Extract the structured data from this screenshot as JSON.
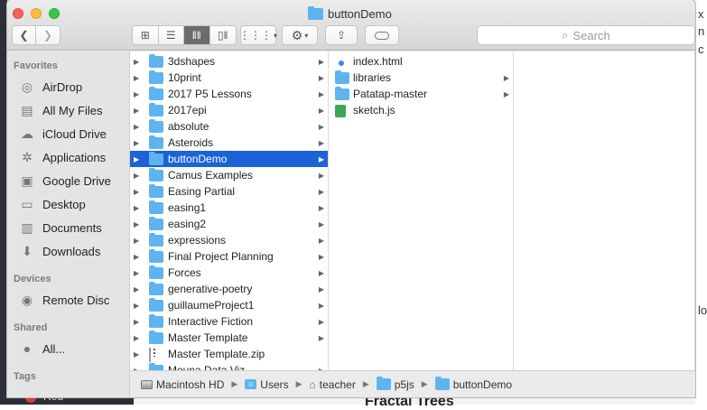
{
  "window": {
    "title": "buttonDemo"
  },
  "toolbar": {
    "back_icon": "chevron-left-icon",
    "forward_icon": "chevron-right-icon",
    "view_modes": [
      "icon-view",
      "list-view",
      "column-view",
      "gallery-view"
    ],
    "active_view": "column-view",
    "search_placeholder": "Search"
  },
  "sidebar": {
    "favorites_label": "Favorites",
    "favorites": [
      {
        "label": "AirDrop",
        "icon": "airdrop-icon"
      },
      {
        "label": "All My Files",
        "icon": "all-files-icon"
      },
      {
        "label": "iCloud Drive",
        "icon": "cloud-icon"
      },
      {
        "label": "Applications",
        "icon": "applications-icon"
      },
      {
        "label": "Google Drive",
        "icon": "google-drive-icon"
      },
      {
        "label": "Desktop",
        "icon": "desktop-icon"
      },
      {
        "label": "Documents",
        "icon": "documents-icon"
      },
      {
        "label": "Downloads",
        "icon": "downloads-icon"
      }
    ],
    "devices_label": "Devices",
    "devices": [
      {
        "label": "Remote Disc",
        "icon": "disc-icon"
      }
    ],
    "shared_label": "Shared",
    "shared": [
      {
        "label": "All...",
        "icon": "network-icon"
      }
    ],
    "tags_label": "Tags"
  },
  "column1": [
    {
      "label": "3dshapes",
      "type": "folder"
    },
    {
      "label": "10print",
      "type": "folder"
    },
    {
      "label": "2017 P5 Lessons",
      "type": "folder"
    },
    {
      "label": "2017epi",
      "type": "folder"
    },
    {
      "label": "absolute",
      "type": "folder"
    },
    {
      "label": "Asteroids",
      "type": "folder"
    },
    {
      "label": "buttonDemo",
      "type": "folder",
      "selected": true
    },
    {
      "label": "Camus Examples",
      "type": "folder"
    },
    {
      "label": "Easing Partial",
      "type": "folder"
    },
    {
      "label": "easing1",
      "type": "folder"
    },
    {
      "label": "easing2",
      "type": "folder"
    },
    {
      "label": "expressions",
      "type": "folder"
    },
    {
      "label": "Final Project Planning",
      "type": "folder"
    },
    {
      "label": "Forces",
      "type": "folder"
    },
    {
      "label": "generative-poetry",
      "type": "folder"
    },
    {
      "label": "guillaumeProject1",
      "type": "folder"
    },
    {
      "label": "Interactive Fiction",
      "type": "folder"
    },
    {
      "label": "Master Template",
      "type": "folder"
    },
    {
      "label": "Master Template.zip",
      "type": "zip"
    },
    {
      "label": "Mouna Data Viz",
      "type": "folder"
    }
  ],
  "column2": [
    {
      "label": "index.html",
      "type": "html"
    },
    {
      "label": "libraries",
      "type": "folder"
    },
    {
      "label": "Patatap-master",
      "type": "folder"
    },
    {
      "label": "sketch.js",
      "type": "js"
    }
  ],
  "pathbar": [
    {
      "label": "Macintosh HD",
      "icon": "hard-drive-icon"
    },
    {
      "label": "Users",
      "icon": "users-folder-icon"
    },
    {
      "label": "teacher",
      "icon": "home-icon"
    },
    {
      "label": "p5js",
      "icon": "folder-icon"
    },
    {
      "label": "buttonDemo",
      "icon": "folder-icon"
    }
  ],
  "background": {
    "bottom_title": "Fractal Trees",
    "tag_red": "Red"
  }
}
